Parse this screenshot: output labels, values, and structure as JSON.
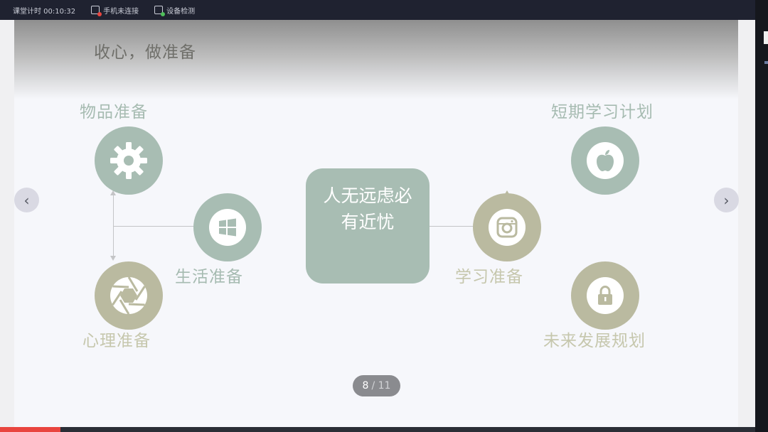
{
  "topbar": {
    "timer": "课堂计时 00:10:32",
    "phone_status": "手机未连接",
    "device_check": "设备检测"
  },
  "slide": {
    "title": "收心，做准备",
    "center_text_line1": "人无远虑必",
    "center_text_line2": "有近忧",
    "items": {
      "wupin": "物品准备",
      "shenghuo": "生活准备",
      "xinli": "心理准备",
      "duanqi": "短期学习计划",
      "xuexi": "学习准备",
      "weilai": "未来发展规划"
    },
    "icons": {
      "wupin": "gear-icon",
      "shenghuo": "windows-icon",
      "xinli": "aperture-icon",
      "duanqi": "apple-icon",
      "xuexi": "camera-icon",
      "weilai": "lock-icon"
    }
  },
  "pager": {
    "current": "8",
    "total": "/ 11"
  },
  "nav": {
    "prev": "‹",
    "next": "›"
  },
  "progress": {
    "fraction": 0.08
  },
  "colors": {
    "green": "#a8bdb3",
    "khaki": "#babaa0",
    "progress": "#e9453f"
  }
}
